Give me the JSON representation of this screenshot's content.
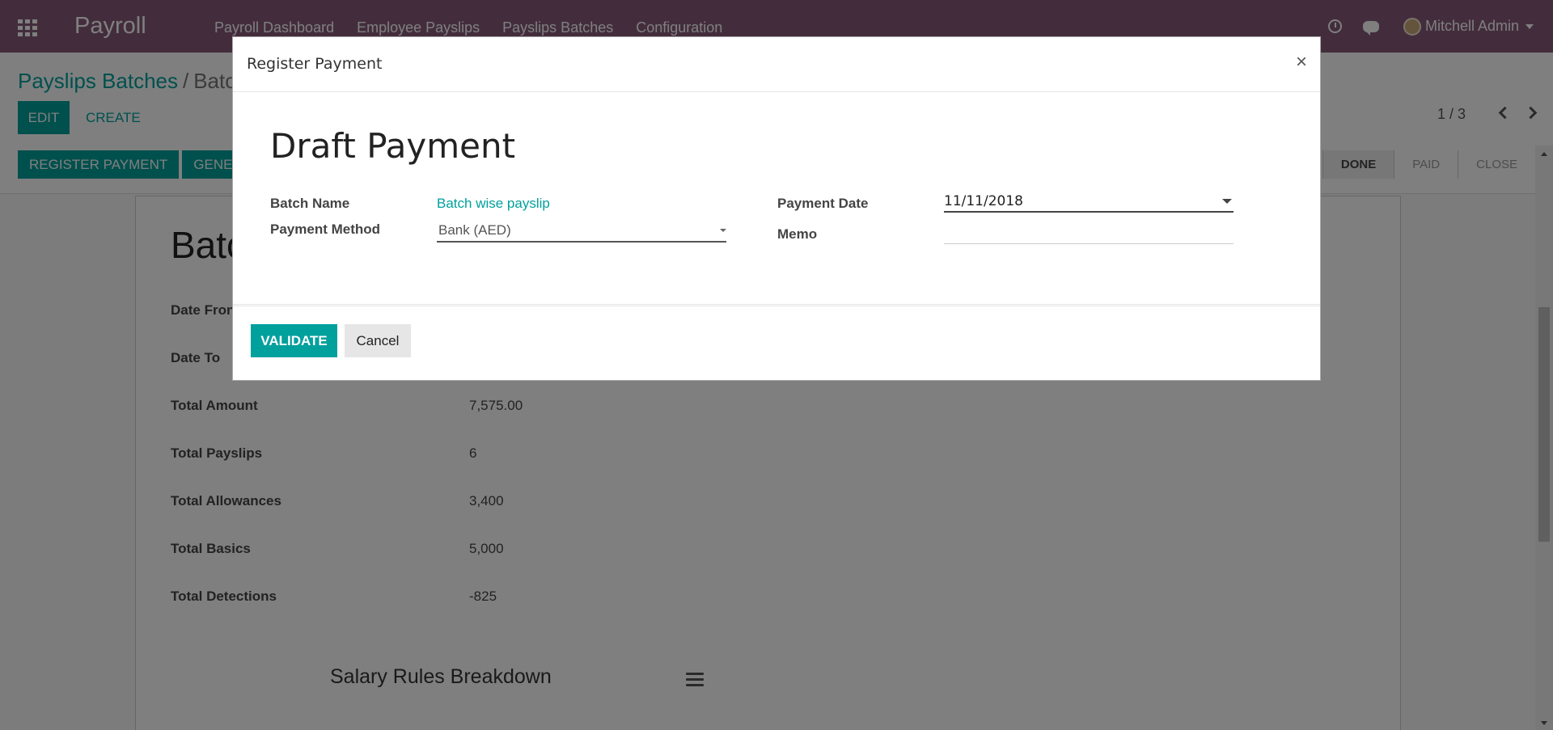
{
  "topbar": {
    "app_name": "Payroll",
    "menu": [
      "Payroll Dashboard",
      "Employee Payslips",
      "Payslips Batches",
      "Configuration"
    ],
    "user": "Mitchell Admin"
  },
  "control_panel": {
    "breadcrumb_link": "Payslips Batches",
    "breadcrumb_sep": "/",
    "breadcrumb_current": "Batc",
    "edit_label": "EDIT",
    "create_label": "CREATE",
    "pager": "1 / 3",
    "status_buttons": [
      "REGISTER PAYMENT",
      "GENER"
    ],
    "stages": [
      "DONE",
      "PAID",
      "CLOSE"
    ]
  },
  "sheet": {
    "title": "Batc",
    "fields": [
      {
        "label": "Date Fron",
        "value": ""
      },
      {
        "label": "Date To",
        "value": ""
      },
      {
        "label": "Total Amount",
        "value": "7,575.00"
      },
      {
        "label": "Total Payslips",
        "value": "6"
      },
      {
        "label": "Total Allowances",
        "value": "3,400"
      },
      {
        "label": "Total Basics",
        "value": "5,000"
      },
      {
        "label": "Total Detections",
        "value": "-825"
      }
    ],
    "chart_title": "Salary Rules Breakdown"
  },
  "modal": {
    "title": "Register Payment",
    "close": "×",
    "form_title": "Draft Payment",
    "batch_name_label": "Batch Name",
    "batch_name_value": "Batch wise payslip",
    "payment_method_label": "Payment Method",
    "payment_method_value": "Bank (AED)",
    "payment_date_label": "Payment Date",
    "payment_date_value": "11/11/2018",
    "memo_label": "Memo",
    "memo_value": "",
    "validate_label": "VALIDATE",
    "cancel_label": "Cancel"
  },
  "colors": {
    "topbar": "#875a7b",
    "accent": "#00a09d"
  }
}
